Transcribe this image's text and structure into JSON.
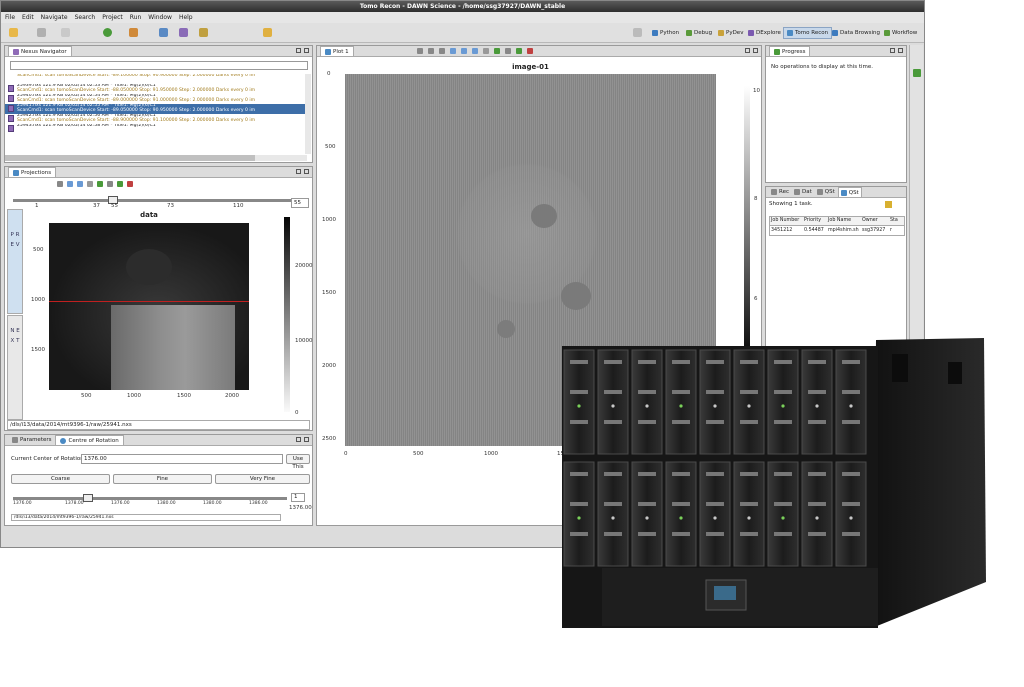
{
  "window": {
    "title": "Tomo Recon - DAWN Science - /home/ssg37927/DAWN_stable"
  },
  "menu": [
    "File",
    "Edit",
    "Navigate",
    "Search",
    "Project",
    "Run",
    "Window",
    "Help"
  ],
  "perspectives": [
    {
      "label": "Python",
      "color": "#3d7bbf"
    },
    {
      "label": "Debug",
      "color": "#5a9a3a"
    },
    {
      "label": "PyDev",
      "color": "#c9a23a"
    },
    {
      "label": "DExplore",
      "color": "#7b5ab0"
    },
    {
      "label": "Tomo Recon",
      "color": "#4a8ac4",
      "active": true
    },
    {
      "label": "Data Browsing",
      "color": "#3d7bbf"
    },
    {
      "label": "Workflow",
      "color": "#5a9a3a"
    }
  ],
  "navigator": {
    "tab": "Nexus Navigator",
    "rows": [
      {
        "file": "",
        "scan": "ScanCmd1: scan tomoScanDevice Start: -89.100000 Stop: 90.900000 Step: 2.000000 Darks every 0 im"
      },
      {
        "file": "25939.nxs  121.9 KB  02/02/14 02:53 AM * Title1: Mg(2)(6)C1",
        "scan": "ScanCmd1: scan tomoScanDevice Start: -88.050000 Stop: 91.950000 Step: 2.000000 Darks every 0 im"
      },
      {
        "file": "25940.nxs  121.9 KB  02/02/14 02:54 AM * Title1: Mg(2)(6)C1",
        "scan": "ScanCmd1: scan tomoScanDevice Start: -89.000000 Stop: 91.000000 Step: 2.000000 Darks every 0 im"
      },
      {
        "file": "25941.nxs  121.9 KB  02/02/14 02:55 AM * Title1: Mg(2)(6)C1",
        "scan": "ScanCmd1: scan tomoScanDevice Start: -89.050000 Stop: 90.950000 Step: 2.000000 Darks every 0 im",
        "selected": true
      },
      {
        "file": "25942.nxs  121.9 KB  02/02/14 02:56 AM * Title1: Mg(2)(6)C1",
        "scan": "ScanCmd1: scan tomoScanDevice Start: -88.900000 Stop: 91.100000 Step: 2.000000 Darks every 0 im"
      },
      {
        "file": "25943.nxs  121.9 KB  02/02/14 02:58 AM * Title1: Mg(2)(6)C1",
        "scan": ""
      }
    ]
  },
  "projections": {
    "tab": "Projections",
    "title": "data",
    "slider_value": "55",
    "side_prev": "P R E V",
    "side_next": "N E X T",
    "slider_ticks": [
      "1",
      "37",
      "55",
      "73",
      "110"
    ],
    "yticks": [
      "500",
      "1000",
      "1500"
    ],
    "xticks": [
      "500",
      "1000",
      "1500",
      "2000"
    ],
    "cbar_ticks": [
      "20000",
      "10000",
      "0"
    ],
    "path": "/dls/i13/data/2014/mt9396-1/raw/25941.nxs"
  },
  "plot": {
    "tab": "Plot 1",
    "title": "image-01",
    "yticks": [
      "0",
      "500",
      "1000",
      "1500",
      "2000",
      "2500"
    ],
    "xticks": [
      "0",
      "500",
      "1000",
      "1500"
    ],
    "cbar_ticks": [
      "10",
      "8",
      "6"
    ]
  },
  "progress": {
    "tab": "Progress",
    "message": "No operations to display at this time."
  },
  "jobs": {
    "tabs": [
      "Rec",
      "Dat",
      "QSt",
      "QSt"
    ],
    "showing": "Showing 1 task.",
    "columns": [
      "Job Number",
      "Priority",
      "Job Name",
      "Owner",
      "Sta"
    ],
    "rows": [
      [
        "3451212",
        "0.54487",
        "mpi4shim.sh",
        "ssg37927",
        "r"
      ]
    ]
  },
  "params": {
    "tabs": [
      "Parameters",
      "Centre of Rotation"
    ],
    "cor_label": "Current Center of Rotation",
    "cor_value": "1376.00",
    "use_this": "Use This",
    "buttons": [
      "Coarse",
      "Fine",
      "Very Fine"
    ],
    "stepper_value": "1",
    "stepper_readout": "1376.00",
    "scale_ticks": [
      "1376.00",
      "1378.00",
      "1376.00",
      "1380.00",
      "1380.00",
      "1386.00"
    ],
    "path": "/dls/i13/data/2014/mt9396-1/raw/25941.nxs"
  }
}
